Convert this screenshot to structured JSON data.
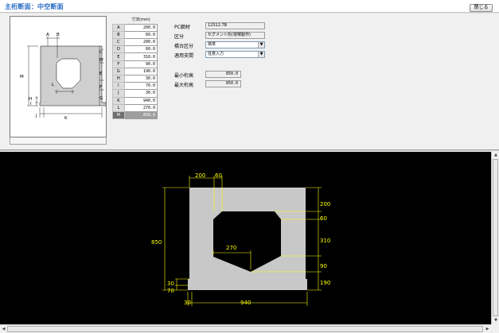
{
  "title": "主桁断面：中空断面",
  "close_button": "閉じる",
  "dim_table": {
    "header": "寸法(mm)",
    "rows": [
      {
        "key": "A",
        "value": "200.0"
      },
      {
        "key": "B",
        "value": "60.0"
      },
      {
        "key": "C",
        "value": "200.0"
      },
      {
        "key": "D",
        "value": "60.0"
      },
      {
        "key": "E",
        "value": "310.0"
      },
      {
        "key": "F",
        "value": "90.0"
      },
      {
        "key": "G",
        "value": "190.0"
      },
      {
        "key": "H",
        "value": "30.0"
      },
      {
        "key": "I",
        "value": "70.0"
      },
      {
        "key": "J",
        "value": "30.0"
      },
      {
        "key": "K",
        "value": "940.0"
      },
      {
        "key": "L",
        "value": "270.0"
      },
      {
        "key": "M",
        "value": "850.0"
      }
    ],
    "selected_key": "M"
  },
  "props": {
    "pc_label": "PC鋼材",
    "pc_value": "12S12.7B",
    "class_label": "区分",
    "class_value": "セグメント桁(現場製作)",
    "section_label": "橋台区分",
    "section_value": "標準",
    "support_label": "適用支間",
    "support_value": "任意入力",
    "min_label": "最小桁高",
    "min_value": "850.0",
    "max_label": "最大桁高",
    "max_value": "850.0"
  },
  "thumbnail_labels": {
    "A": "A",
    "B": "B",
    "C": "C",
    "D": "D",
    "E": "E",
    "F": "F",
    "G": "G",
    "H": "H",
    "I": "I",
    "J": "J",
    "K": "K",
    "L": "L",
    "M": "M"
  },
  "drawing_labels": {
    "top_a": "200",
    "top_b": "60",
    "right_c": "200",
    "right_d": "60",
    "right_e": "310",
    "right_f": "90",
    "right_g": "190",
    "left_m": "850",
    "left_h": "30",
    "left_i": "70",
    "inner_l": "270",
    "bottom_j": "30",
    "bottom_k": "940"
  },
  "colors": {
    "title": "#2b6cc4",
    "canvas_bg": "#000000",
    "section_fill": "#c8c8c8",
    "dimension_lines": "#ffff00",
    "thumb_fill": "#cfcfcf"
  }
}
